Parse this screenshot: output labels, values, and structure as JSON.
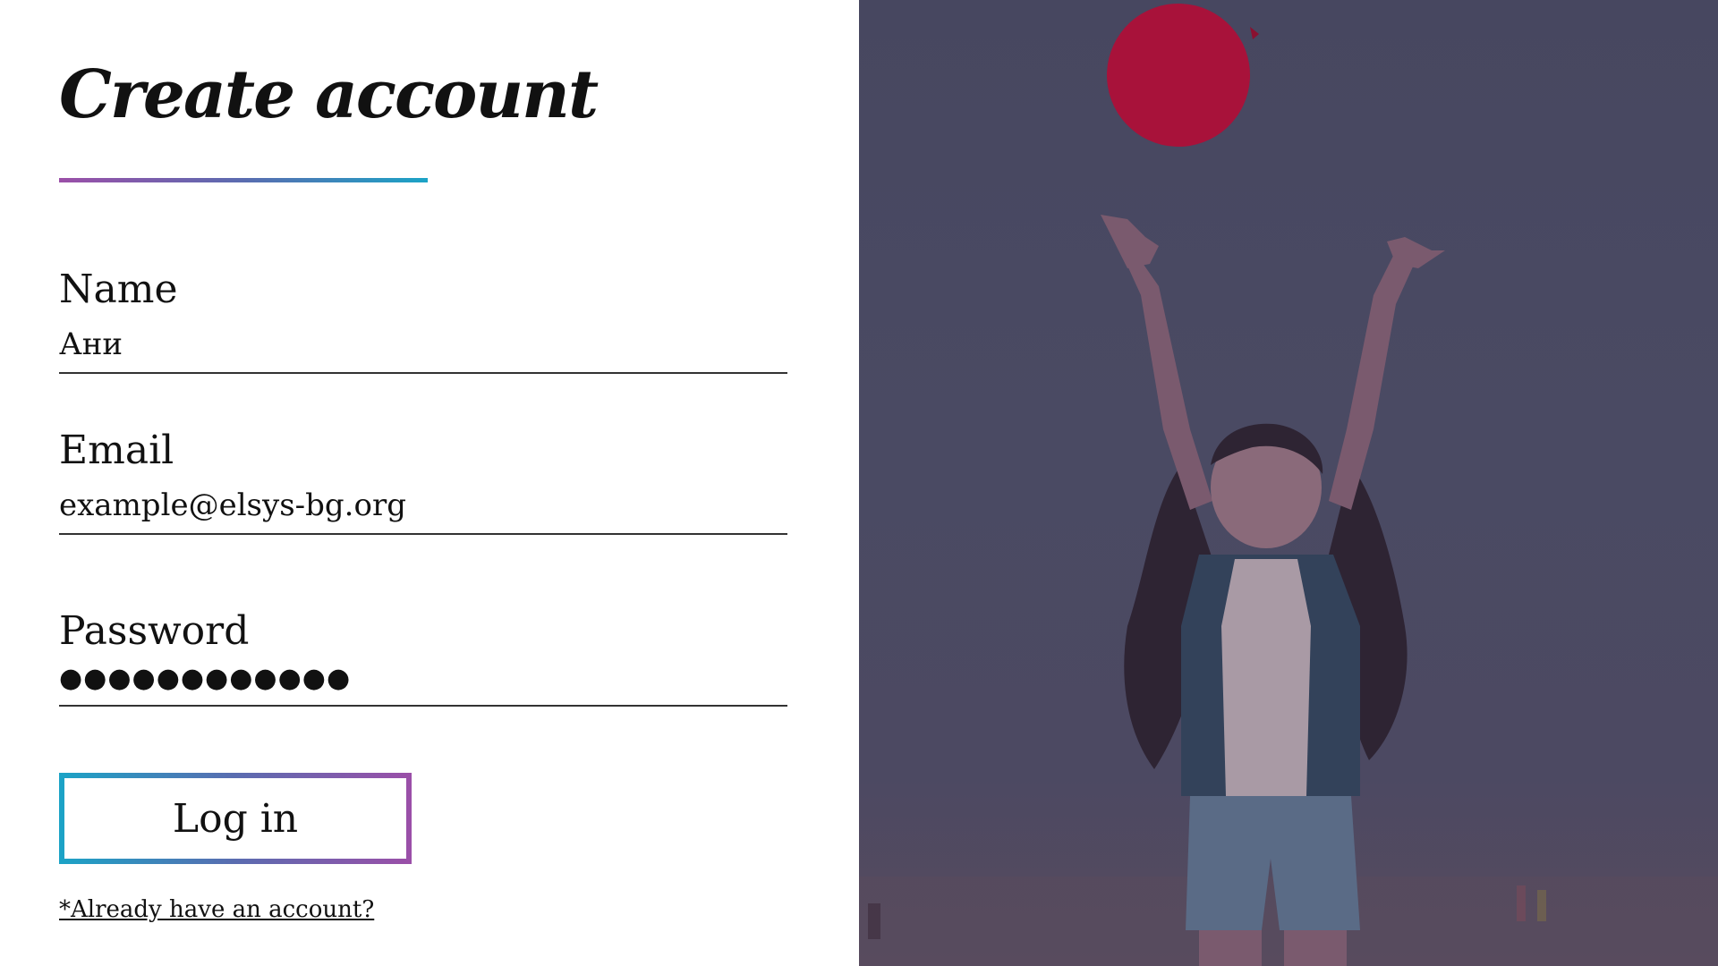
{
  "form": {
    "title": "Create account",
    "fields": [
      {
        "label": "Name",
        "value": "Ани"
      },
      {
        "label": "Email",
        "value": "example@elsys-bg.org"
      },
      {
        "label": "Password",
        "value": "●●●●●●●●●●●●"
      }
    ],
    "submit_label": "Log in",
    "account_link": "*Already have an account?"
  },
  "colors": {
    "accent_purple": "#9b4fa8",
    "accent_teal": "#1ba3c6",
    "overlay": "#474760",
    "balloon": "#b0123a"
  },
  "photo": {
    "icon": "girl-with-balloon-photo"
  }
}
